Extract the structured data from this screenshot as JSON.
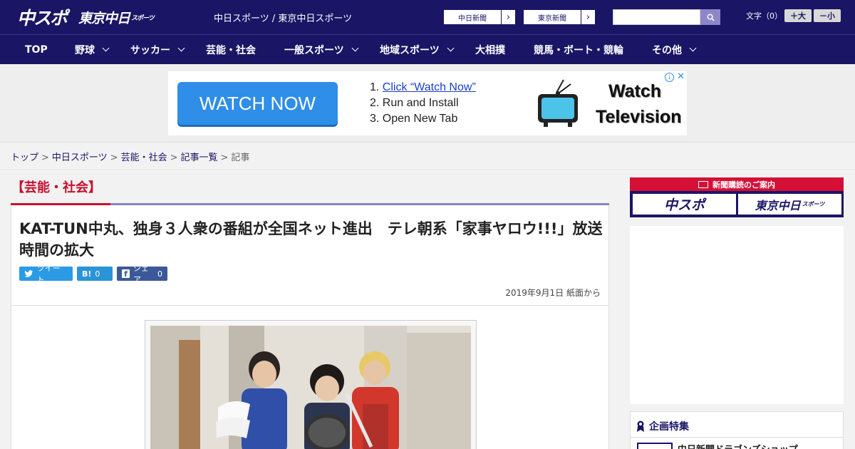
{
  "header": {
    "logo_main": "中スポ",
    "logo_tokyo": "東京中日",
    "logo_tokyo_small": "スポーツ",
    "site_name": "中日スポーツ / 東京中日スポーツ",
    "paper_links": [
      "中日新聞",
      "東京新聞"
    ],
    "search_placeholder": "",
    "font_size_label": "文字（0）",
    "font_larger": "＋大",
    "font_smaller": "－小"
  },
  "nav": {
    "items": [
      {
        "label": "TOP",
        "dropdown": false
      },
      {
        "label": "野球",
        "dropdown": true
      },
      {
        "label": "サッカー",
        "dropdown": true
      },
      {
        "label": "芸能・社会",
        "dropdown": false
      },
      {
        "label": "一般スポーツ",
        "dropdown": true
      },
      {
        "label": "地域スポーツ",
        "dropdown": true
      },
      {
        "label": "大相撲",
        "dropdown": false
      },
      {
        "label": "競馬・ボート・競輪",
        "dropdown": false
      },
      {
        "label": "その他",
        "dropdown": true
      }
    ]
  },
  "ad": {
    "button": "WATCH NOW",
    "step1_prefix": "1. ",
    "step1_link": "Click “Watch Now”",
    "step2": "2. Run and Install",
    "step3": "3. Open New Tab",
    "title_line1": "Watch",
    "title_line2": "Television",
    "info": "i",
    "close": "✕"
  },
  "breadcrumb": {
    "items": [
      "トップ",
      "中日スポーツ",
      "芸能・社会",
      "記事一覧"
    ],
    "current": "記事",
    "separator": ">"
  },
  "article": {
    "category": "【芸能・社会】",
    "title": "KAT-TUN中丸、独身３人衆の番組が全国ネット進出　テレ朝系「家事ヤロウ!!!」放送時間の拡大",
    "share_tweet": "ツイート",
    "share_hatena_icon": "B!",
    "share_hatena_count": "0",
    "share_fb": "シェア",
    "share_fb_count": "0",
    "date": "2019年9月1日 紙面から"
  },
  "sidebar": {
    "subscription_head": "新聞購読のご案内",
    "sub_logo_1": "中スポ",
    "sub_logo_2": "東京中日",
    "sub_logo_2_small": "スポーツ",
    "feature_title": "企画特集",
    "feature_item": "中日新聞ドラゴンズショップ"
  },
  "colors": {
    "brand_navy": "#1a1565",
    "accent_red": "#c7102e",
    "accent_purple": "#8a82c4",
    "twitter_blue": "#2b9be6",
    "facebook_blue": "#3b5998"
  }
}
